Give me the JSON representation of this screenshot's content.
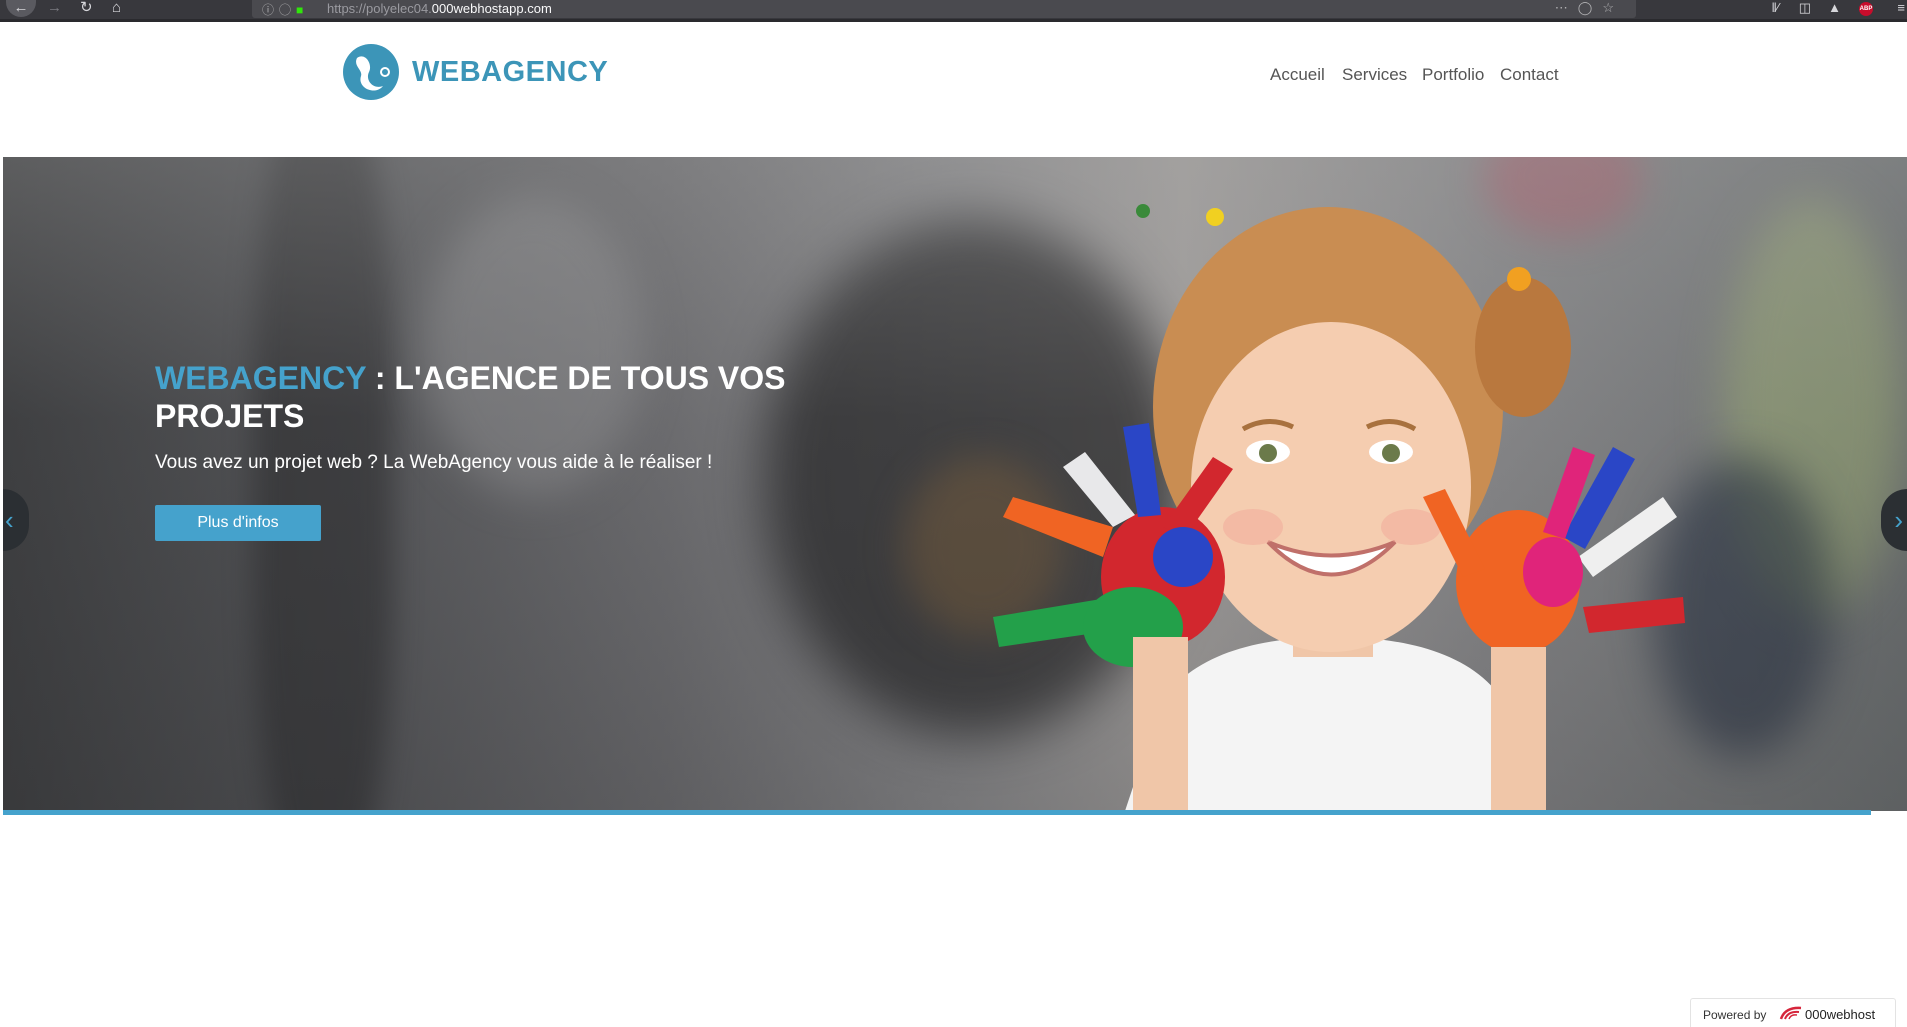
{
  "browser": {
    "url_prefix": "https://polyelec04.",
    "url_domain": "000webhostapp.com",
    "abp_label": "ABP"
  },
  "site": {
    "brand": "WEBAGENCY",
    "nav": [
      "Accueil",
      "Services",
      "Portfolio",
      "Contact"
    ]
  },
  "hero": {
    "title_brand": "WEBAGENCY",
    "title_rest": " : L'AGENCE DE TOUS VOS PROJETS",
    "subtitle": "Vous avez un projet web ? La WebAgency vous aide à le réaliser !",
    "button": "Plus d'infos",
    "prev_icon": "chevron-left-icon",
    "next_icon": "chevron-right-icon"
  },
  "badge": {
    "prefix": "Powered by",
    "name": "000webhost"
  },
  "colors": {
    "accent": "#45a2cc",
    "logo": "#3c95b8"
  }
}
